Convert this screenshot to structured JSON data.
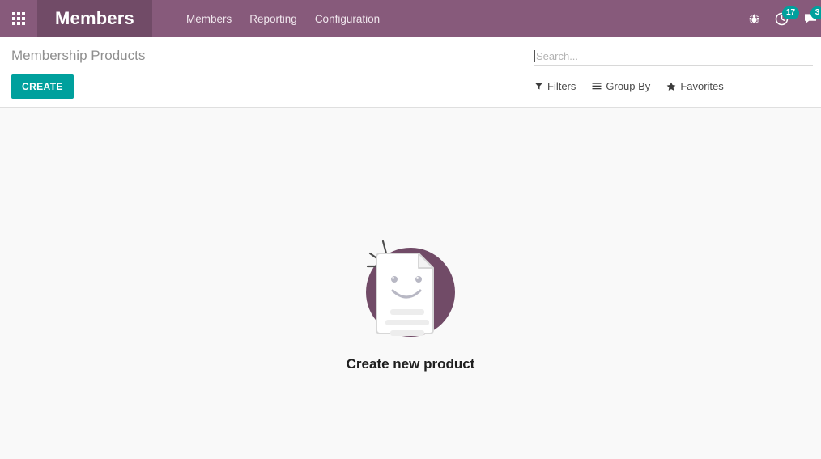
{
  "navbar": {
    "apps_icon": "apps-grid-icon",
    "brand": "Members",
    "menu": [
      {
        "label": "Members"
      },
      {
        "label": "Reporting"
      },
      {
        "label": "Configuration"
      }
    ],
    "right_icons": [
      {
        "name": "debug-bug-icon",
        "badge": ""
      },
      {
        "name": "activity-clock-icon",
        "badge": "17"
      },
      {
        "name": "messages-bubble-icon",
        "badge": "3"
      }
    ],
    "colors": {
      "navbar_bg": "#875a7b",
      "brand_bg": "#714b67",
      "badge_bg": "#00a09d"
    }
  },
  "control_panel": {
    "title": "Membership Products",
    "create_label": "CREATE",
    "create_color": "#00a09d",
    "search": {
      "placeholder": "Search...",
      "value": ""
    },
    "filters": [
      {
        "icon": "funnel-icon",
        "label": "Filters"
      },
      {
        "icon": "list-icon",
        "label": "Group By"
      },
      {
        "icon": "star-icon",
        "label": "Favorites"
      }
    ]
  },
  "content": {
    "empty_state": {
      "illustration": "smiling-document-icon",
      "circle_color": "#714b67",
      "text": "Create new product"
    }
  }
}
